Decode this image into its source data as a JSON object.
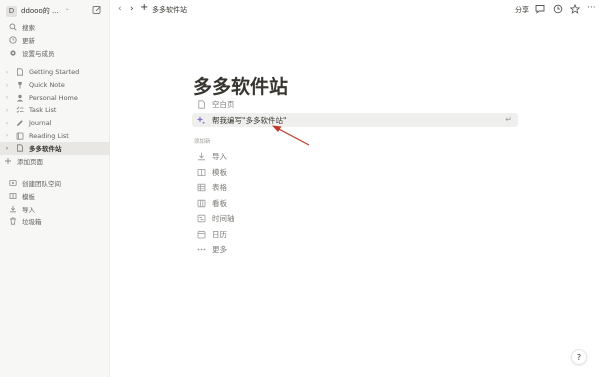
{
  "workspace": {
    "initial": "D",
    "name": "ddooo的 ..."
  },
  "sidebar": {
    "top": [
      {
        "label": "搜索",
        "icon": "search-icon"
      },
      {
        "label": "更新",
        "icon": "clock-icon"
      },
      {
        "label": "设置与成员",
        "icon": "gear-icon"
      }
    ],
    "pages": [
      {
        "label": "Getting Started",
        "icon": "page-icon"
      },
      {
        "label": "Quick Note",
        "icon": "pin-icon"
      },
      {
        "label": "Personal Home",
        "icon": "person-icon"
      },
      {
        "label": "Task List",
        "icon": "checklist-icon"
      },
      {
        "label": "Journal",
        "icon": "pencil-icon"
      },
      {
        "label": "Reading List",
        "icon": "book-icon"
      },
      {
        "label": "多多软件站",
        "icon": "page-icon",
        "active": true
      }
    ],
    "add_page": "添加页面",
    "bottom": [
      {
        "label": "创建团队空间",
        "icon": "team-icon"
      },
      {
        "label": "模板",
        "icon": "template-icon"
      },
      {
        "label": "导入",
        "icon": "import-icon"
      },
      {
        "label": "垃圾箱",
        "icon": "trash-icon"
      }
    ]
  },
  "topbar": {
    "breadcrumb": "多多软件站",
    "share": "分享"
  },
  "page": {
    "title": "多多软件站",
    "blank_page": "空白页",
    "ai_prompt": "帮我编写\"多多软件站\"",
    "enter_symbol": "↵",
    "add_new_heading": "添加新",
    "options": [
      {
        "label": "导入",
        "icon": "import-icon"
      },
      {
        "label": "模板",
        "icon": "template-icon"
      },
      {
        "label": "表格",
        "icon": "table-icon"
      },
      {
        "label": "看板",
        "icon": "board-icon"
      },
      {
        "label": "时间轴",
        "icon": "timeline-icon"
      },
      {
        "label": "日历",
        "icon": "calendar-icon"
      },
      {
        "label": "更多",
        "icon": "more-icon"
      }
    ]
  },
  "help": "?",
  "colors": {
    "sidebar_bg": "#f7f7f5",
    "arrow": "#c0392b",
    "highlight": "#efefed"
  }
}
